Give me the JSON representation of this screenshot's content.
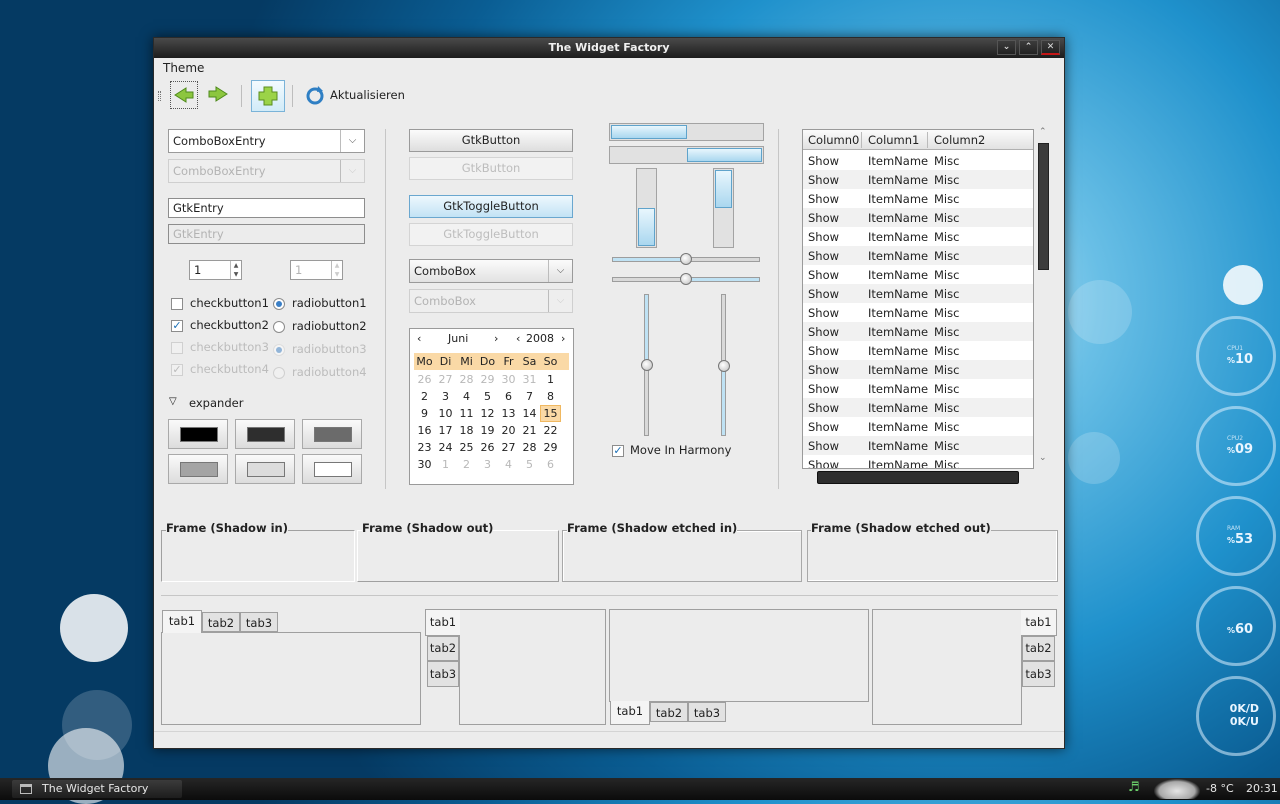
{
  "window": {
    "title": "The Widget Factory",
    "controls": [
      "minimize",
      "maximize",
      "close"
    ]
  },
  "menu": {
    "theme": "Theme"
  },
  "toolbar": {
    "refresh_label": "Aktualisieren"
  },
  "left": {
    "combo_entry": "ComboBoxEntry",
    "combo_entry_disabled": "ComboBoxEntry",
    "entry": "GtkEntry",
    "entry_disabled_placeholder": "GtkEntry",
    "spin_value": "1",
    "spin_disabled_value": "1",
    "checks": [
      {
        "label": "checkbutton1",
        "checked": false
      },
      {
        "label": "checkbutton2",
        "checked": true
      },
      {
        "label": "checkbutton3",
        "checked": false,
        "disabled": true
      },
      {
        "label": "checkbutton4",
        "checked": true,
        "disabled": true
      }
    ],
    "radios": [
      {
        "label": "radiobutton1",
        "selected": true
      },
      {
        "label": "radiobutton2",
        "selected": false
      },
      {
        "label": "radiobutton3",
        "selected": true,
        "disabled": true
      },
      {
        "label": "radiobutton4",
        "selected": false,
        "disabled": true
      }
    ],
    "expander": "expander",
    "swatch_colors": [
      "#000000",
      "#2e2e2e",
      "#6b6b6b",
      "#a4a4a4",
      "#dcdcdc",
      "#ffffff"
    ]
  },
  "middle": {
    "button": "GtkButton",
    "button_disabled": "GtkButton",
    "toggle": "GtkToggleButton",
    "toggle_disabled": "GtkToggleButton",
    "combo": "ComboBox",
    "combo_disabled": "ComboBox"
  },
  "calendar": {
    "month": "Juni",
    "year": "2008",
    "days": [
      "Mo",
      "Di",
      "Mi",
      "Do",
      "Fr",
      "Sa",
      "So"
    ],
    "rows": [
      [
        "26",
        "27",
        "28",
        "29",
        "30",
        "31",
        "1"
      ],
      [
        "2",
        "3",
        "4",
        "5",
        "6",
        "7",
        "8"
      ],
      [
        "9",
        "10",
        "11",
        "12",
        "13",
        "14",
        "15"
      ],
      [
        "16",
        "17",
        "18",
        "19",
        "20",
        "21",
        "22"
      ],
      [
        "23",
        "24",
        "25",
        "26",
        "27",
        "28",
        "29"
      ],
      [
        "30",
        "1",
        "2",
        "3",
        "4",
        "5",
        "6"
      ]
    ],
    "selected_day": "15"
  },
  "progress": {
    "h1": 0.5,
    "h2": 0.5,
    "v1": 0.5,
    "v2": 0.5
  },
  "sliders": {
    "h1": 0.5,
    "h2": 0.5,
    "v1": 0.5,
    "v2": 0.5
  },
  "harmony": {
    "label": "Move In Harmony",
    "checked": true
  },
  "tree": {
    "columns": [
      "Column0",
      "Column1",
      "Column2"
    ],
    "rows": [
      [
        "Show",
        "ItemName",
        "Misc"
      ],
      [
        "Show",
        "ItemName",
        "Misc"
      ],
      [
        "Show",
        "ItemName",
        "Misc"
      ],
      [
        "Show",
        "ItemName",
        "Misc"
      ],
      [
        "Show",
        "ItemName",
        "Misc"
      ],
      [
        "Show",
        "ItemName",
        "Misc"
      ],
      [
        "Show",
        "ItemName",
        "Misc"
      ],
      [
        "Show",
        "ItemName",
        "Misc"
      ],
      [
        "Show",
        "ItemName",
        "Misc"
      ],
      [
        "Show",
        "ItemName",
        "Misc"
      ],
      [
        "Show",
        "ItemName",
        "Misc"
      ],
      [
        "Show",
        "ItemName",
        "Misc"
      ],
      [
        "Show",
        "ItemName",
        "Misc"
      ],
      [
        "Show",
        "ItemName",
        "Misc"
      ],
      [
        "Show",
        "ItemName",
        "Misc"
      ],
      [
        "Show",
        "ItemName",
        "Misc"
      ],
      [
        "Show",
        "ItemName",
        "Misc"
      ]
    ]
  },
  "frames": [
    "Frame (Shadow in)",
    "Frame (Shadow out)",
    "Frame (Shadow etched in)",
    "Frame (Shadow etched out)"
  ],
  "tabs": [
    "tab1",
    "tab2",
    "tab3"
  ],
  "desktop": {
    "gauges": [
      {
        "caption": "CPU1",
        "value": "10",
        "unit": "%"
      },
      {
        "caption": "CPU2",
        "value": "09",
        "unit": "%"
      },
      {
        "caption": "RAM",
        "value": "53",
        "unit": "%"
      },
      {
        "caption": "",
        "value": "60",
        "unit": "%"
      },
      {
        "down": "0K/D",
        "up": "0K/U"
      }
    ]
  },
  "taskbar": {
    "task": "The Widget Factory",
    "temperature": "-8 °C",
    "time": "20:31"
  }
}
